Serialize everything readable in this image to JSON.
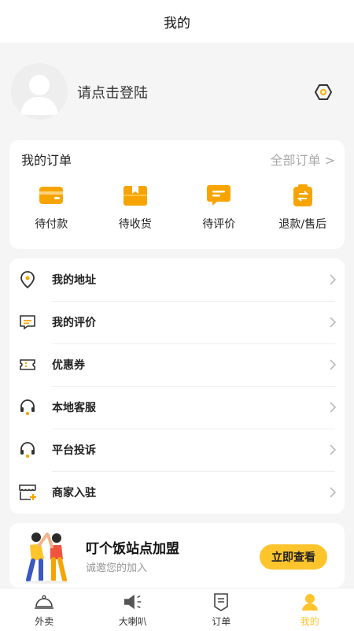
{
  "header": {
    "title": "我的"
  },
  "profile": {
    "login_text": "请点击登陆"
  },
  "orders": {
    "title": "我的订单",
    "all_link": "全部订单 >",
    "items": [
      {
        "label": "待付款",
        "icon": "wallet-icon"
      },
      {
        "label": "待收货",
        "icon": "package-icon"
      },
      {
        "label": "待评价",
        "icon": "comment-icon"
      },
      {
        "label": "退款/售后",
        "icon": "refund-icon"
      }
    ]
  },
  "menu": {
    "items": [
      {
        "label": "我的地址",
        "icon": "location-pin-icon"
      },
      {
        "label": "我的评价",
        "icon": "message-icon"
      },
      {
        "label": "优惠券",
        "icon": "coupon-icon"
      },
      {
        "label": "本地客服",
        "icon": "headset-icon"
      },
      {
        "label": "平台投诉",
        "icon": "headset-icon"
      },
      {
        "label": "商家入驻",
        "icon": "store-icon"
      }
    ]
  },
  "banner": {
    "title": "叮个饭站点加盟",
    "subtitle": "诚邀您的加入",
    "button": "立即查看"
  },
  "tabbar": {
    "items": [
      {
        "label": "外卖",
        "icon": "food-cloche-icon"
      },
      {
        "label": "大喇叭",
        "icon": "megaphone-icon"
      },
      {
        "label": "订单",
        "icon": "order-list-icon"
      },
      {
        "label": "我的",
        "icon": "user-icon",
        "active": true
      }
    ]
  },
  "colors": {
    "accent": "#fdc42c",
    "order_icon": "#f7a400",
    "background": "#f5f5f5"
  }
}
